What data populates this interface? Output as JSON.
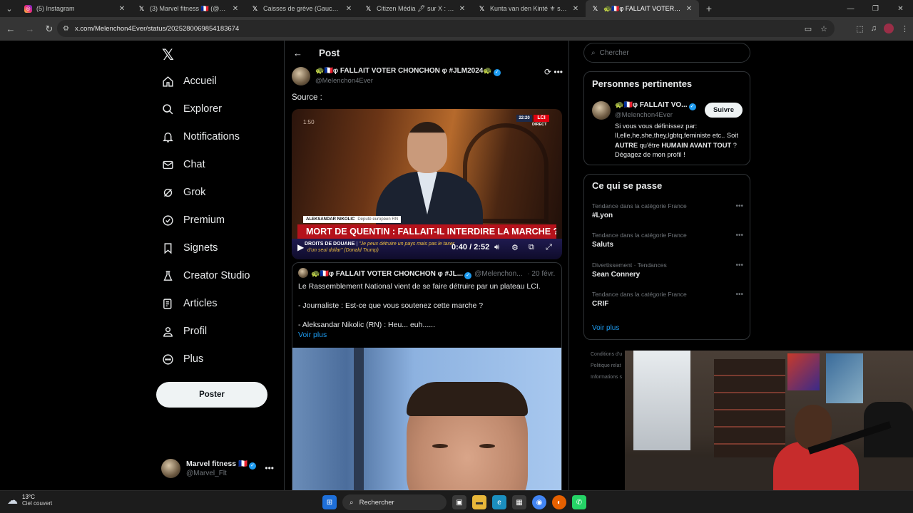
{
  "browser": {
    "tabs": [
      {
        "title": "(5) Instagram",
        "favicon": "instagram-icon",
        "active": false
      },
      {
        "title": "(3) Marvel fitness 🇫🇷 (@Marvel_Flt) / X",
        "favicon": "x-icon",
        "active": false
      },
      {
        "title": "Caisses de grève (Gauche Gaza)",
        "favicon": "x-icon",
        "active": false
      },
      {
        "title": "Citizen Média 🖋 sur X : \"🇫🇷 🇮",
        "favicon": "x-icon",
        "active": false
      },
      {
        "title": "Kunta van den Kinté ⚜ sur X : \"",
        "favicon": "x-icon",
        "active": false
      },
      {
        "title": "🐢🇫🇷φ FALLAIT VOTER CHONCHON",
        "favicon": "x-icon",
        "active": true
      }
    ],
    "url": "x.com/Melenchon4Ever/status/2025280069854183674"
  },
  "nav": {
    "logo": "𝕏",
    "items": [
      {
        "label": "Accueil",
        "icon": "home-icon"
      },
      {
        "label": "Explorer",
        "icon": "search-icon"
      },
      {
        "label": "Notifications",
        "icon": "bell-icon"
      },
      {
        "label": "Chat",
        "icon": "mail-icon"
      },
      {
        "label": "Grok",
        "icon": "grok-icon"
      },
      {
        "label": "Premium",
        "icon": "premium-icon"
      },
      {
        "label": "Signets",
        "icon": "bookmark-icon"
      },
      {
        "label": "Creator Studio",
        "icon": "flask-icon"
      },
      {
        "label": "Articles",
        "icon": "article-icon"
      },
      {
        "label": "Profil",
        "icon": "person-icon"
      },
      {
        "label": "Plus",
        "icon": "more-circle-icon"
      }
    ],
    "post_button": "Poster",
    "account": {
      "name": "Marvel fitness 🇫🇷",
      "handle": "@Marvel_Flt"
    }
  },
  "post": {
    "header_title": "Post",
    "author_name": "🐢🇫🇷φ FALLAIT VOTER CHONCHON φ #JLM2024🐢",
    "author_handle": "@Melenchon4Ever",
    "text": "Source :",
    "video": {
      "timer_overlay": "1:50",
      "clock": "22:20",
      "channel": "LCI",
      "live": "DIRECT",
      "speaker_name": "ALEKSANDAR NIKOLIC",
      "speaker_role": "Député européen RN",
      "headline": "MORT DE QUENTIN : FALLAIT-IL INTERDIRE LA MARCHE ?",
      "ticker_label": "DROITS DE DOUANE",
      "ticker_text": "\"Je peux détruire un pays mais pas le taxer",
      "ticker_text2": "d'un seul dollar\" (Donald Trump)",
      "time": "0:40 / 2:52",
      "progress_fraction": 0.23
    },
    "quote": {
      "author_name": "🐢🇫🇷φ FALLAIT VOTER CHONCHON φ #JL...",
      "author_handle": "@Melenchon...",
      "date": "· 20 févr.",
      "lines": [
        "Le Rassemblement National vient de se faire détruire par un plateau LCI.",
        "- Journaliste : Est-ce que vous soutenez cette marche ?",
        "- Aleksandar Nikolic (RN) : Heu... euh......"
      ],
      "show_more": "Voir plus"
    }
  },
  "right": {
    "search_placeholder": "Chercher",
    "related_title": "Personnes pertinentes",
    "related": {
      "name": "🐢🇫🇷φ FALLAIT VO...",
      "handle": "@Melenchon4Ever",
      "follow": "Suivre",
      "bio1": "Si vous vous définissez par: Il,elle,he,she,they,lgbtq,feministe etc.. Soit ",
      "bio_bold1": "AUTRE",
      "bio2": " qu'être ",
      "bio_bold2": "HUMAIN AVANT TOUT",
      "bio3": " ? Dégagez de mon profil !"
    },
    "trends_title": "Ce qui se passe",
    "trends": [
      {
        "meta": "Tendance dans la catégorie France",
        "name": "#Lyon"
      },
      {
        "meta": "Tendance dans la catégorie France",
        "name": "Saluts"
      },
      {
        "meta": "Divertissement · Tendances",
        "name": "Sean Connery"
      },
      {
        "meta": "Tendance dans la catégorie France",
        "name": "CRIF"
      }
    ],
    "show_more": "Voir plus",
    "footer": [
      "Conditions d'u",
      "Politique relat",
      "Informations s"
    ]
  },
  "taskbar": {
    "temp": "13°C",
    "weather": "Ciel couvert",
    "search": "Rechercher"
  }
}
